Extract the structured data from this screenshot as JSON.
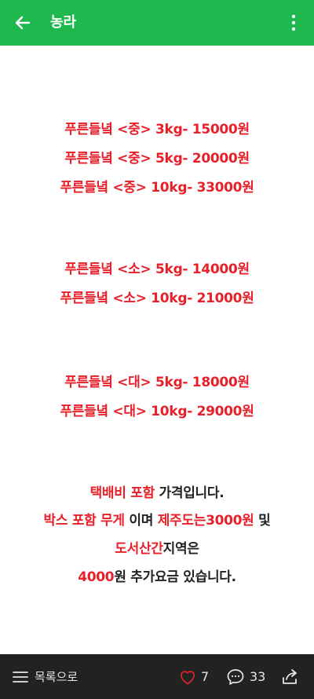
{
  "header": {
    "title": "농라",
    "back_icon": "arrow-left-icon",
    "more_icon": "more-vertical-icon",
    "bg_color": "#1fb84e"
  },
  "prices": {
    "mid": [
      "푸른들녘 <중> 3kg- 15000원",
      "푸른들녘 <중> 5kg- 20000원",
      "푸른들녘 <중> 10kg- 33000원"
    ],
    "small": [
      "푸른들녘 <소> 5kg- 14000원",
      "푸른들녘 <소> 10kg- 21000원"
    ],
    "large": [
      "푸른들녘 <대> 5kg- 18000원",
      "푸른들녘 <대> 10kg- 29000원"
    ],
    "color": "#e8202a"
  },
  "notice": {
    "line1_red": "택배비 포함",
    "line1_black": " 가격입니다.",
    "line2_red1": "박스 포함 무게",
    "line2_black1": " 이며 ",
    "line2_red2": "제주도는3000원",
    "line2_black2": " 및",
    "line3_red": "도서산간",
    "line3_black": "지역은",
    "line4_red": "4000",
    "line4_black": "원 추가요금 있습니다."
  },
  "footer": {
    "list_label": "목록으로",
    "likes": "7",
    "comments": "33",
    "list_icon": "menu-icon",
    "like_icon": "heart-icon",
    "comment_icon": "comment-icon",
    "share_icon": "share-icon"
  }
}
